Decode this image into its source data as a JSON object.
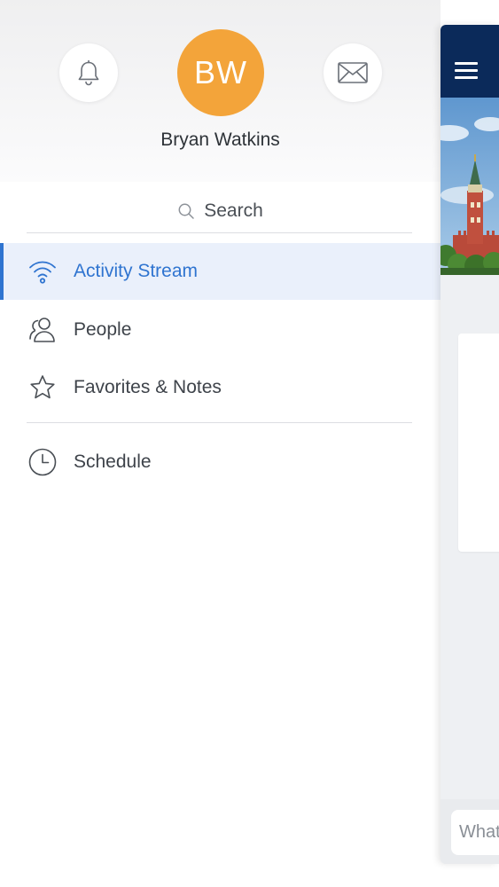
{
  "profile": {
    "initials": "BW",
    "name": "Bryan Watkins",
    "avatar_color": "#f3a43a"
  },
  "header_actions": {
    "notifications_icon": "bell-icon",
    "messages_icon": "mail-icon"
  },
  "search": {
    "label": "Search",
    "icon": "search-icon"
  },
  "nav": {
    "items": [
      {
        "label": "Activity Stream",
        "icon": "wifi-icon",
        "active": true
      },
      {
        "label": "People",
        "icon": "people-icon",
        "active": false
      },
      {
        "label": "Favorites & Notes",
        "icon": "star-icon",
        "active": false
      },
      {
        "label": "Schedule",
        "icon": "clock-icon",
        "active": false
      }
    ]
  },
  "main": {
    "menu_icon": "hamburger-icon",
    "composer_placeholder": "What"
  },
  "colors": {
    "accent": "#2f74d0",
    "active_bg": "#eaf0fb",
    "top_bar": "#0b2a5a"
  }
}
